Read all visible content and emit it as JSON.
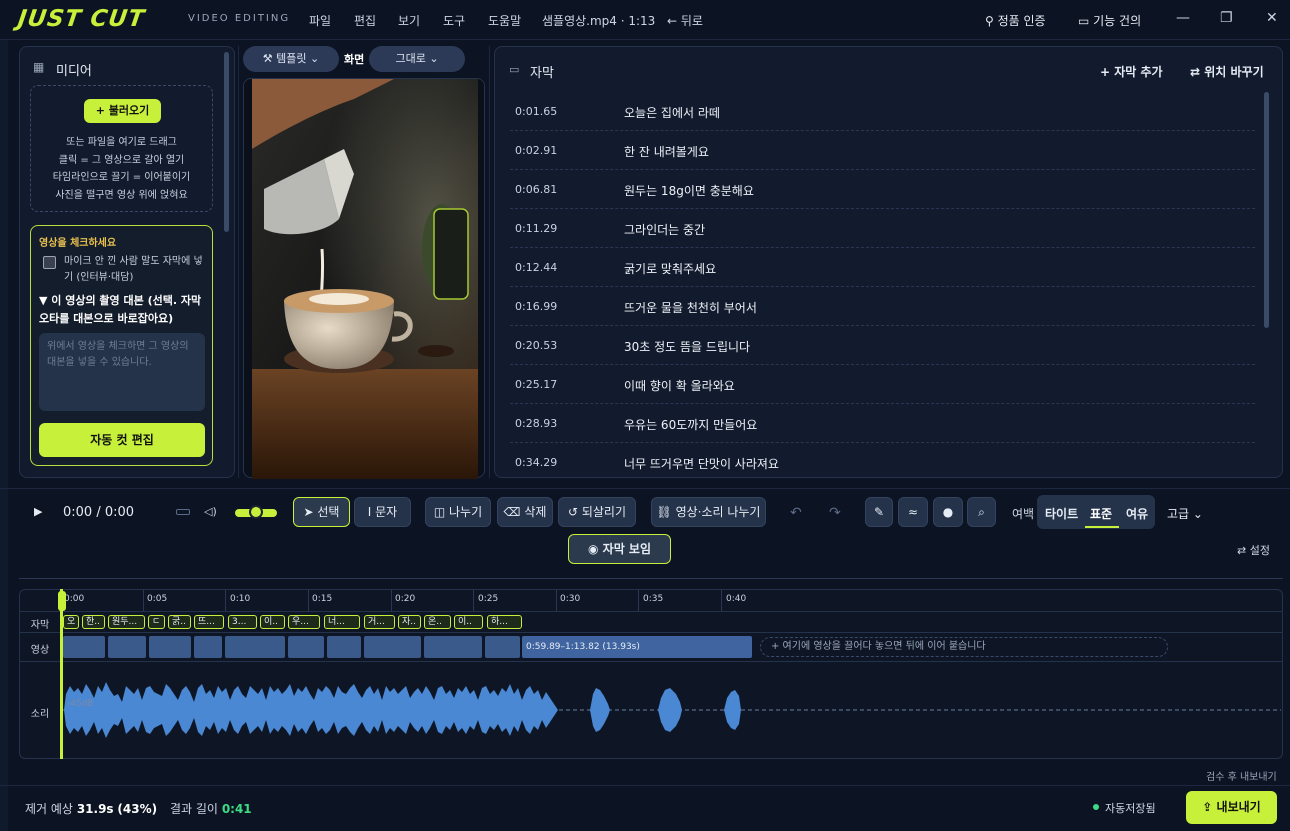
{
  "app": {
    "logo": "JUST CUT",
    "subtitle": "VIDEO EDITING",
    "menu": [
      "파일",
      "편집",
      "보기",
      "도구",
      "도움말"
    ],
    "file_info": "샘플영상.mp4 · 1:13",
    "back_label": "← 뒤로",
    "license_label": "정품 인증",
    "feedback_label": "기능 건의",
    "accent": "#c6f03a"
  },
  "media": {
    "title": "미디어",
    "load_button": "+ 불러오기",
    "drop_lines": [
      "또는 파일을 여기로 드래그",
      "클릭 = 그 영상으로 갈아 열기",
      "타임라인으로 끌기 = 이어붙이기",
      "사진을 떨구면 영상 위에 얹혀요"
    ]
  },
  "check": {
    "title": "영상을 체크하세요",
    "checkbox_label": "마이크 안 낀 사람 말도 자막에 넣기 (인터뷰·대담)",
    "script_title": "▼ 이 영상의 촬영 대본 (선택. 자막 오타를 대본으로 바로잡아요)",
    "script_placeholder": "위에서 영상을 체크하면 그 영상의 대본을 넣을 수 있습니다.",
    "auto_button": "자동 컷 편집"
  },
  "video": {
    "template_button": "템플릿",
    "screen_label": "화면",
    "fit_button": "그대로"
  },
  "subtitles": {
    "title": "자막",
    "add_label": "+ 자막 추가",
    "swap_label": "⇄ 위치 바꾸기",
    "rows": [
      {
        "time": "0:01.65",
        "text": "오늘은 집에서 라떼"
      },
      {
        "time": "0:02.91",
        "text": "한 잔 내려볼게요"
      },
      {
        "time": "0:06.81",
        "text": "원두는 18g이면 충분해요"
      },
      {
        "time": "0:11.29",
        "text": "그라인더는 중간"
      },
      {
        "time": "0:12.44",
        "text": "굵기로 맞춰주세요"
      },
      {
        "time": "0:16.99",
        "text": "뜨거운 물을 천천히 부어서"
      },
      {
        "time": "0:20.53",
        "text": "30초 정도 뜸을 드립니다"
      },
      {
        "time": "0:25.17",
        "text": "이때 향이 확 올라와요"
      },
      {
        "time": "0:28.93",
        "text": "우유는 60도까지 만들어요"
      },
      {
        "time": "0:34.29",
        "text": "너무 뜨거우면 단맛이 사라져요"
      }
    ]
  },
  "toolbar": {
    "time": "0:00 / 0:00",
    "select": "선택",
    "text": "문자",
    "split": "나누기",
    "delete": "삭제",
    "undo": "되살리기",
    "av_split": "영상·소리 나누기",
    "margin_label": "여백",
    "margin_options": [
      "타이트",
      "표준",
      "여유"
    ],
    "advanced": "고급",
    "sub_show": "자막 보임",
    "settings": "설정",
    "volume": 0.6
  },
  "timeline": {
    "ticks": [
      "0:00",
      "0:05",
      "0:10",
      "0:15",
      "0:20",
      "0:25",
      "0:30",
      "0:35",
      "0:40"
    ],
    "row_labels": [
      "자막",
      "영상",
      "소리"
    ],
    "chips": [
      "오",
      "한..",
      "원두...",
      "ㄷ",
      "굵..",
      "뜨...",
      "3...",
      "이..",
      "우...",
      "너...",
      "거...",
      "자..",
      "온..",
      "이..",
      "하..."
    ],
    "last_clip": "0:59.89–1:13.82 (13.93s)",
    "append_hint": "+ 여기에 영상을 끌어다 놓으면 뒤에 이어 붙습니다",
    "db_label": "-45dB",
    "inspect_label": "검수 후 내보내기"
  },
  "footer": {
    "est_prefix": "제거 예상",
    "est_value": "31.9s",
    "est_percent": "(43%)",
    "result_prefix": "결과 길이",
    "result_value": "0:41",
    "autosave": "자동저장됨",
    "export": "내보내기"
  }
}
